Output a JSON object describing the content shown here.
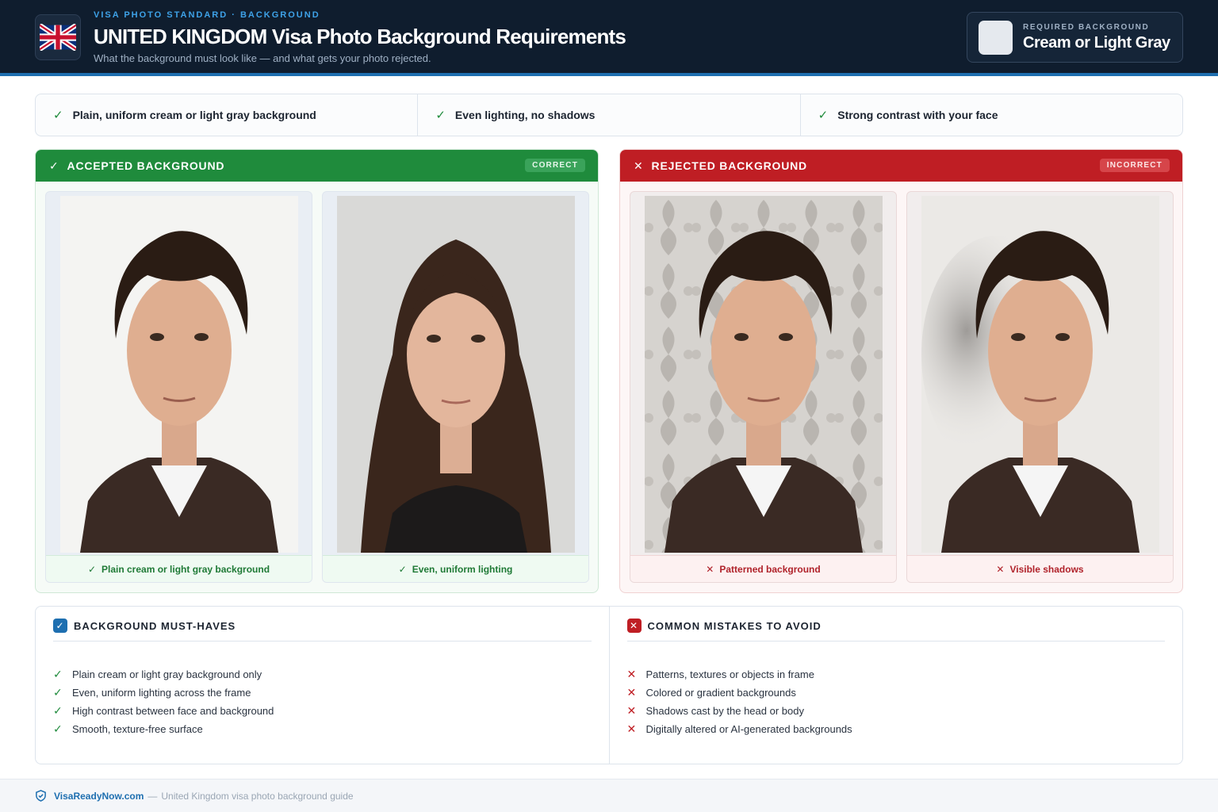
{
  "header": {
    "eyebrow": "VISA PHOTO STANDARD · BACKGROUND",
    "title": "UNITED KINGDOM Visa Photo Background Requirements",
    "subtitle": "What the background must look like — and what gets your photo rejected.",
    "flag_icon": "uk-flag-icon",
    "required_label": "REQUIRED BACKGROUND",
    "required_value": "Cream or Light Gray",
    "required_swatch_color": "#e5e9ee"
  },
  "checks": [
    {
      "label": "Plain, uniform cream or light gray background"
    },
    {
      "label": "Even lighting, no shadows"
    },
    {
      "label": "Strong contrast with your face"
    }
  ],
  "accepted": {
    "title": "ACCEPTED BACKGROUND",
    "badge": "CORRECT",
    "color": "#1f8b3c",
    "cards": [
      {
        "caption": "Plain cream or light gray background"
      },
      {
        "caption": "Even, uniform lighting"
      }
    ]
  },
  "rejected": {
    "title": "REJECTED BACKGROUND",
    "badge": "INCORRECT",
    "color": "#bf1e24",
    "cards": [
      {
        "caption": "Patterned background"
      },
      {
        "caption": "Visible shadows"
      }
    ]
  },
  "must_haves": {
    "title": "BACKGROUND MUST-HAVES",
    "items": [
      "Plain cream or light gray background only",
      "Even, uniform lighting across the frame",
      "High contrast between face and background",
      "Smooth, texture-free surface"
    ]
  },
  "mistakes": {
    "title": "COMMON MISTAKES TO AVOID",
    "items": [
      "Patterns, textures or objects in frame",
      "Colored or gradient backgrounds",
      "Shadows cast by the head or body",
      "Digitally altered or AI-generated backgrounds"
    ]
  },
  "footer": {
    "brand": "VisaReadyNow.com",
    "dash": "—",
    "text": "United Kingdom visa photo background guide"
  }
}
